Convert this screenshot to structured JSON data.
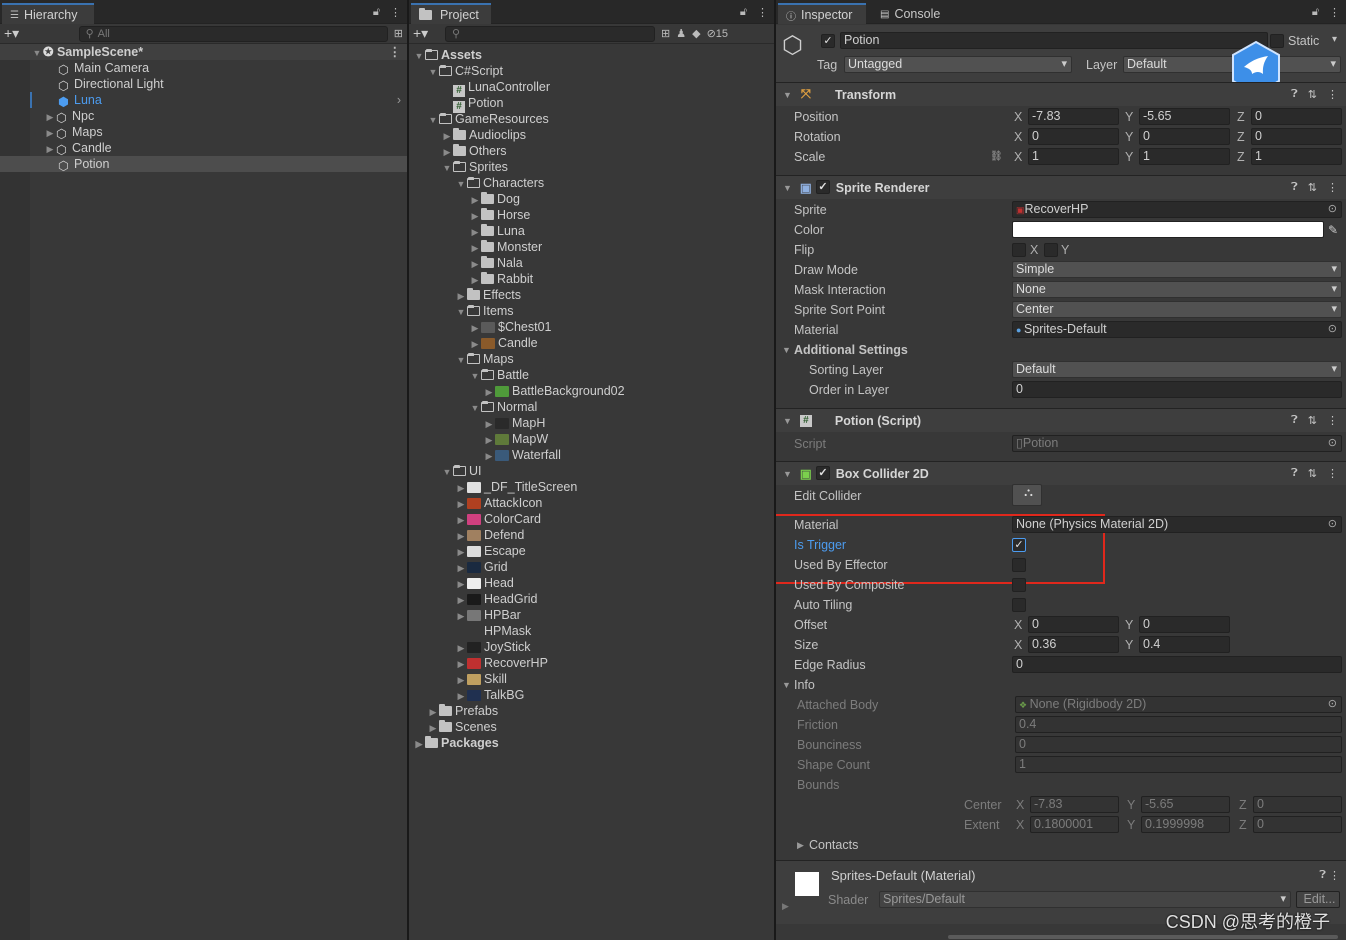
{
  "hierarchy": {
    "tab": "Hierarchy",
    "search_placeholder": "All",
    "scene": "SampleScene*",
    "items": [
      "Main Camera",
      "Directional Light",
      "Luna",
      "Npc",
      "Maps",
      "Candle",
      "Potion"
    ]
  },
  "project": {
    "tab": "Project",
    "count": "15",
    "rows": [
      "Assets",
      "C#Script",
      "LunaController",
      "Potion",
      "GameResources",
      "Audioclips",
      "Others",
      "Sprites",
      "Characters",
      "Dog",
      "Horse",
      "Luna",
      "Monster",
      "Nala",
      "Rabbit",
      "Effects",
      "Items",
      "$Chest01",
      "Candle",
      "Maps",
      "Battle",
      "BattleBackground02",
      "Normal",
      "MapH",
      "MapW",
      "Waterfall",
      "UI",
      "_DF_TitleScreen",
      "AttackIcon",
      "ColorCard",
      "Defend",
      "Escape",
      "Grid",
      "Head",
      "HeadGrid",
      "HPBar",
      "HPMask",
      "JoyStick",
      "RecoverHP",
      "Skill",
      "TalkBG",
      "Prefabs",
      "Scenes",
      "Packages"
    ]
  },
  "inspector": {
    "tab": "Inspector",
    "console_tab": "Console",
    "object_name": "Potion",
    "static_label": "Static",
    "tag_label": "Tag",
    "tag_value": "Untagged",
    "layer_label": "Layer",
    "layer_value": "Default",
    "transform": {
      "title": "Transform",
      "position_label": "Position",
      "position": [
        "-7.83",
        "-5.65",
        "0"
      ],
      "rotation_label": "Rotation",
      "rotation": [
        "0",
        "0",
        "0"
      ],
      "scale_label": "Scale",
      "scale": [
        "1",
        "1",
        "1"
      ]
    },
    "axes": {
      "x": "X",
      "y": "Y",
      "z": "Z"
    },
    "sprite_renderer": {
      "title": "Sprite Renderer",
      "sprite_label": "Sprite",
      "sprite": "RecoverHP",
      "color_label": "Color",
      "flip_label": "Flip",
      "draw_mode_label": "Draw Mode",
      "draw_mode": "Simple",
      "mask_label": "Mask Interaction",
      "mask": "None",
      "sort_point_label": "Sprite Sort Point",
      "sort_point": "Center",
      "material_label": "Material",
      "material": "Sprites-Default",
      "additional": "Additional Settings",
      "sorting_layer_label": "Sorting Layer",
      "sorting_layer": "Default",
      "order_label": "Order in Layer",
      "order": "0"
    },
    "potion_script": {
      "title": "Potion (Script)",
      "script_label": "Script",
      "script": "Potion"
    },
    "box_collider": {
      "title": "Box Collider 2D",
      "edit_label": "Edit Collider",
      "material_label": "Material",
      "material": "None (Physics Material 2D)",
      "trigger_label": "Is Trigger",
      "effector_label": "Used By Effector",
      "composite_label": "Used By Composite",
      "tiling_label": "Auto Tiling",
      "offset_label": "Offset",
      "offset": [
        "0",
        "0"
      ],
      "size_label": "Size",
      "size": [
        "0.36",
        "0.4"
      ],
      "edge_label": "Edge Radius",
      "edge": "0",
      "info_label": "Info",
      "body_label": "Attached Body",
      "body": "None (Rigidbody 2D)",
      "friction_label": "Friction",
      "friction": "0.4",
      "bounciness_label": "Bounciness",
      "bounciness": "0",
      "shape_label": "Shape Count",
      "shape": "1",
      "bounds_label": "Bounds",
      "center_label": "Center",
      "center": [
        "-7.83",
        "-5.65",
        "0"
      ],
      "extent_label": "Extent",
      "extent": [
        "0.1800001",
        "0.1999998",
        "0"
      ],
      "contacts_label": "Contacts"
    },
    "material_section": {
      "title": "Sprites-Default (Material)",
      "shader_label": "Shader",
      "shader": "Sprites/Default",
      "edit": "Edit..."
    }
  },
  "watermark": "CSDN @思考的橙子",
  "colors": {
    "highlight_box": "#e0281c",
    "accent": "#3a72b0",
    "selection_text": "#4c9cf0"
  }
}
